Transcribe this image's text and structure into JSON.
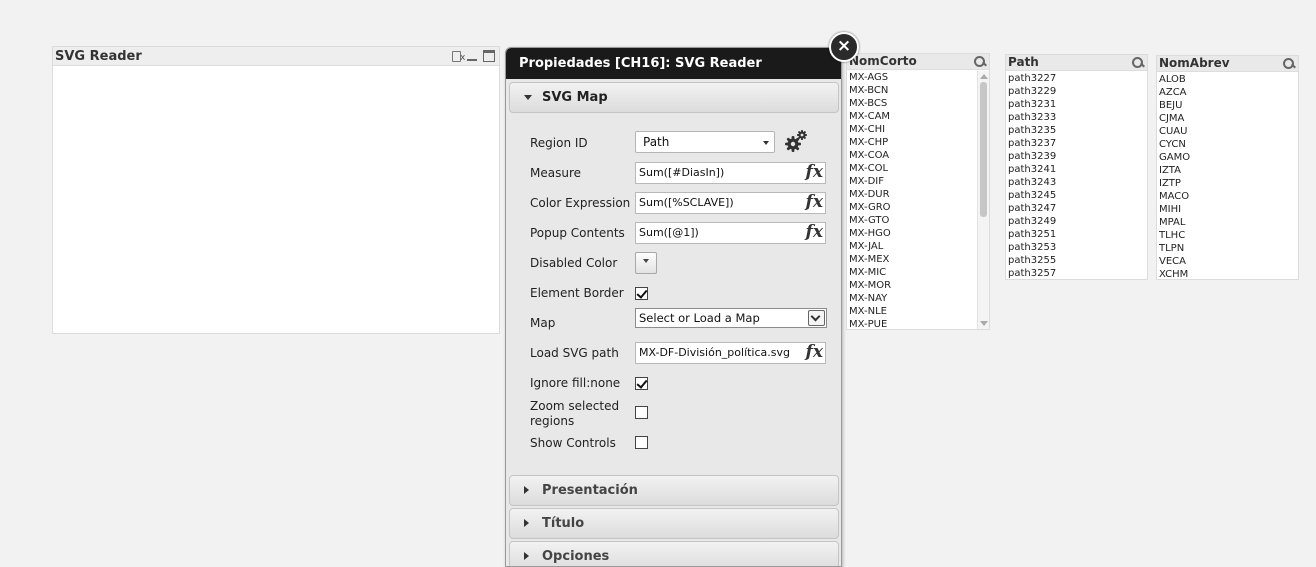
{
  "reader": {
    "title": "SVG Reader"
  },
  "dialog": {
    "title": "Propiedades [CH16]: SVG Reader",
    "close_label": "×",
    "sections": {
      "svg_map": "SVG Map",
      "presentacion": "Presentación",
      "titulo": "Título",
      "opciones": "Opciones"
    },
    "props": {
      "region_id_label": "Region ID",
      "region_id_value": "Path",
      "measure_label": "Measure",
      "measure_value": "Sum([#DiasIn])",
      "color_expr_label": "Color Expression",
      "color_expr_value": "Sum([%SCLAVE])",
      "popup_label": "Popup Contents",
      "popup_value": "Sum([@1])",
      "disabled_color_label": "Disabled Color",
      "element_border_label": "Element Border",
      "element_border_checked": true,
      "map_label": "Map",
      "map_value": "Select or Load a Map",
      "load_svg_label": "Load SVG path",
      "load_svg_value": "MX-DF-División_política.svg",
      "ignore_fill_label": "Ignore fill:none",
      "ignore_fill_checked": true,
      "zoom_label_line1": "Zoom selected",
      "zoom_label_line2": "regions",
      "zoom_checked": false,
      "show_controls_label": "Show Controls",
      "show_controls_checked": false,
      "fx": "fx"
    }
  },
  "listboxes": {
    "nomcorto": {
      "title": "NomCorto",
      "items": [
        "MX-AGS",
        "MX-BCN",
        "MX-BCS",
        "MX-CAM",
        "MX-CHI",
        "MX-CHP",
        "MX-COA",
        "MX-COL",
        "MX-DIF",
        "MX-DUR",
        "MX-GRO",
        "MX-GTO",
        "MX-HGO",
        "MX-JAL",
        "MX-MEX",
        "MX-MIC",
        "MX-MOR",
        "MX-NAY",
        "MX-NLE",
        "MX-PUE"
      ]
    },
    "path": {
      "title": "Path",
      "items": [
        "path3227",
        "path3229",
        "path3231",
        "path3233",
        "path3235",
        "path3237",
        "path3239",
        "path3241",
        "path3243",
        "path3245",
        "path3247",
        "path3249",
        "path3251",
        "path3253",
        "path3255",
        "path3257"
      ]
    },
    "nomabrev": {
      "title": "NomAbrev",
      "items": [
        "ALOB",
        "AZCA",
        "BEJU",
        "CJMA",
        "CUAU",
        "CYCN",
        "GAMO",
        "IZTA",
        "IZTP",
        "MACO",
        "MIHI",
        "MPAL",
        "TLHC",
        "TLPN",
        "VECA",
        "XCHM"
      ]
    }
  },
  "colors": {
    "dialog_header": "#1a1a1a",
    "background": "#f2f2f2"
  }
}
